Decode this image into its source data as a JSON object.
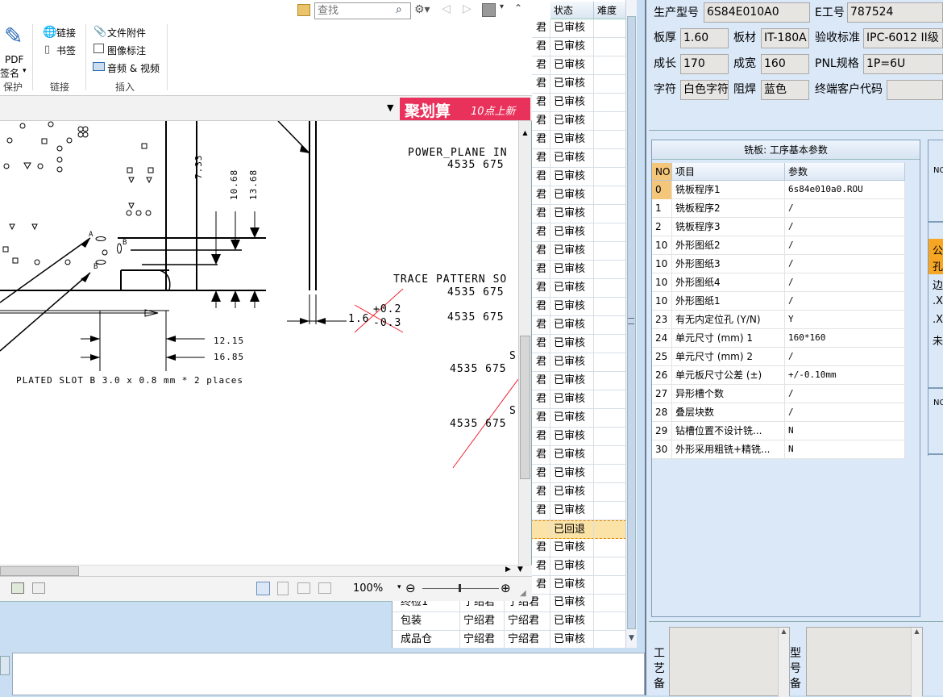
{
  "search": {
    "placeholder": "查找"
  },
  "ribbon": {
    "pdf_sign_line1": "PDF",
    "pdf_sign_line2": "签名",
    "group_protect": "保护",
    "link": "链接",
    "bookmark": "书签",
    "group_link": "链接",
    "file_attach": "文件附件",
    "image_mark": "图像标注",
    "audio_video": "音频 & 视频",
    "group_insert": "插入"
  },
  "ad": {
    "title": "聚划算",
    "sub": "10点上新"
  },
  "drawing": {
    "dim1": "7.33",
    "dim2": "10.68",
    "dim3": "13.68",
    "dim4": "12.15",
    "dim5": "16.85",
    "tol_plus": "+0.2",
    "tol_base": "1.6",
    "tol_minus": "-0.3",
    "power_plane": "POWER_PLANE IN",
    "trace": "TRACE PATTERN SO",
    "pn1": "4535 675",
    "pn2": "4535 675",
    "pn3": "4535 675",
    "pn4": "4535 675",
    "pn5": "4535 675",
    "s1": "S",
    "s2": "S",
    "slot": "PLATED SLOT B  3.0 x 0.8 mm * 2 places",
    "markA": "A",
    "markB1": "B",
    "markB2": "B"
  },
  "zoom": "100%",
  "midtable": {
    "col_status": "状态",
    "col_difficulty": "难度",
    "rows": [
      {
        "c1": "君",
        "status": "已审核"
      },
      {
        "c1": "君",
        "status": "已审核"
      },
      {
        "c1": "君",
        "status": "已审核"
      },
      {
        "c1": "君",
        "status": "已审核"
      },
      {
        "c1": "君",
        "status": "已审核"
      },
      {
        "c1": "君",
        "status": "已审核"
      },
      {
        "c1": "君",
        "status": "已审核"
      },
      {
        "c1": "君",
        "status": "已审核"
      },
      {
        "c1": "君",
        "status": "已审核"
      },
      {
        "c1": "君",
        "status": "已审核"
      },
      {
        "c1": "君",
        "status": "已审核"
      },
      {
        "c1": "君",
        "status": "已审核"
      },
      {
        "c1": "君",
        "status": "已审核"
      },
      {
        "c1": "君",
        "status": "已审核"
      },
      {
        "c1": "君",
        "status": "已审核"
      },
      {
        "c1": "君",
        "status": "已审核"
      },
      {
        "c1": "君",
        "status": "已审核"
      },
      {
        "c1": "君",
        "status": "已审核"
      },
      {
        "c1": "君",
        "status": "已审核"
      },
      {
        "c1": "君",
        "status": "已审核"
      },
      {
        "c1": "君",
        "status": "已审核"
      },
      {
        "c1": "君",
        "status": "已审核"
      },
      {
        "c1": "君",
        "status": "已审核"
      },
      {
        "c1": "君",
        "status": "已审核"
      },
      {
        "c1": "君",
        "status": "已审核"
      },
      {
        "c1": "君",
        "status": "已审核"
      },
      {
        "c1": "君",
        "status": "已审核"
      },
      {
        "c1": "",
        "status": "已回退"
      },
      {
        "c1": "君",
        "status": "已审核"
      },
      {
        "c1": "君",
        "status": "已审核"
      },
      {
        "c1": "君",
        "status": "已审核"
      }
    ],
    "bottom_rows": [
      {
        "proc": "终检1",
        "a": "宁绍君",
        "b": "宁绍君",
        "status": "已审核"
      },
      {
        "proc": "包装",
        "a": "宁绍君",
        "b": "宁绍君",
        "status": "已审核"
      },
      {
        "proc": "成品仓",
        "a": "宁绍君",
        "b": "宁绍君",
        "status": "已审核"
      }
    ]
  },
  "info": {
    "model_label": "生产型号",
    "model_value": "6S84E010A0",
    "eng_label": "E工号",
    "eng_value": "787524",
    "thick_label": "板厚",
    "thick_value": "1.60",
    "mat_label": "板材",
    "mat_value": "IT-180A",
    "std_label": "验收标准",
    "std_value": "IPC-6012 II级",
    "len_label": "成长",
    "len_value": "170",
    "wid_label": "成宽",
    "wid_value": "160",
    "pnl_label": "PNL规格",
    "pnl_value": "1P=6U",
    "char_label": "字符",
    "char_value": "白色字符",
    "mask_label": "阻焊",
    "mask_value": "蓝色",
    "cust_label": "终端客户代码",
    "cust_value": ""
  },
  "grid": {
    "title": "铣板: 工序基本参数",
    "col_no": "NO",
    "col_item": "项目",
    "col_param": "参数",
    "rows": [
      {
        "no": "0",
        "item": "铣板程序1",
        "param": "6s84e010a0.ROU"
      },
      {
        "no": "1",
        "item": "铣板程序2",
        "param": "/"
      },
      {
        "no": "2",
        "item": "铣板程序3",
        "param": "/"
      },
      {
        "no": "10",
        "item": "外形图纸2",
        "param": "/"
      },
      {
        "no": "10",
        "item": "外形图纸3",
        "param": "/"
      },
      {
        "no": "10",
        "item": "外形图纸4",
        "param": "/"
      },
      {
        "no": "10",
        "item": "外形图纸1",
        "param": "/"
      },
      {
        "no": "23",
        "item": "有无内定位孔 (Y/N)",
        "param": "Y"
      },
      {
        "no": "24",
        "item": "单元尺寸 (mm) 1",
        "param": "160*160"
      },
      {
        "no": "25",
        "item": "单元尺寸 (mm) 2",
        "param": "/"
      },
      {
        "no": "26",
        "item": "单元板尺寸公差 (±)",
        "param": "+/-0.10mm"
      },
      {
        "no": "27",
        "item": "异形槽个数",
        "param": "/"
      },
      {
        "no": "28",
        "item": "叠层块数",
        "param": "/"
      },
      {
        "no": "29",
        "item": "钻槽位置不设计铣...",
        "param": "N"
      },
      {
        "no": "30",
        "item": "外形采用粗铣+精铣...",
        "param": "N"
      }
    ]
  },
  "side": {
    "no_label": "NO",
    "no_label2": "NO",
    "t1": "公",
    "t2": "孔",
    "t3": "边",
    "t4": ".X",
    "t5": ".X",
    "t6": "未"
  },
  "notes": {
    "craft_label": "工艺备",
    "model_label": "型号备"
  }
}
